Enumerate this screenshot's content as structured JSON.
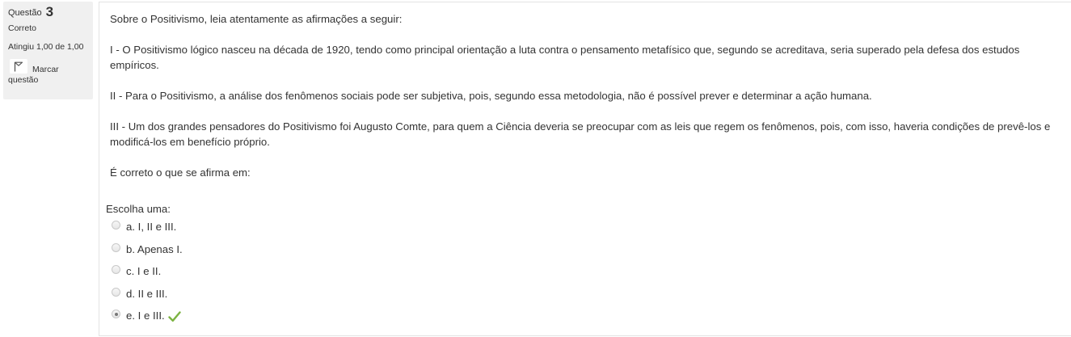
{
  "question_info": {
    "label": "Questão",
    "number": "3",
    "status": "Correto",
    "grade": "Atingiu 1,00 de 1,00",
    "flag_label_line1": "Marcar",
    "flag_label_line2": "questão",
    "flag_icon": "flag-icon"
  },
  "question": {
    "intro": "Sobre o Positivismo, leia atentamente as afirmações a seguir:",
    "statement_1": "I - O Positivismo lógico nasceu na década de 1920, tendo como principal orientação a luta contra o pensamento metafísico que, segundo se acreditava, seria superado pela defesa dos estudos empíricos.",
    "statement_2": "II - Para o Positivismo, a análise dos fenômenos sociais pode ser subjetiva, pois, segundo essa metodologia, não é possível prever e determinar a ação humana.",
    "statement_3": "III - Um dos grandes pensadores do Positivismo foi Augusto Comte, para quem a Ciência deveria se preocupar com as leis que regem os fenômenos, pois, com isso, haveria condições de prevê-los e modificá-los em benefício próprio.",
    "ask": "É correto o que se afirma em:"
  },
  "answer": {
    "prompt": "Escolha uma:",
    "options": [
      {
        "label": "a. I, II e III.",
        "selected": false
      },
      {
        "label": "b. Apenas I.",
        "selected": false
      },
      {
        "label": "c. I e II.",
        "selected": false
      },
      {
        "label": "d. II e III.",
        "selected": false
      },
      {
        "label": "e. I e III.",
        "selected": true
      }
    ],
    "correct_icon": "checkmark-icon",
    "correct_color": "#7cb342"
  }
}
